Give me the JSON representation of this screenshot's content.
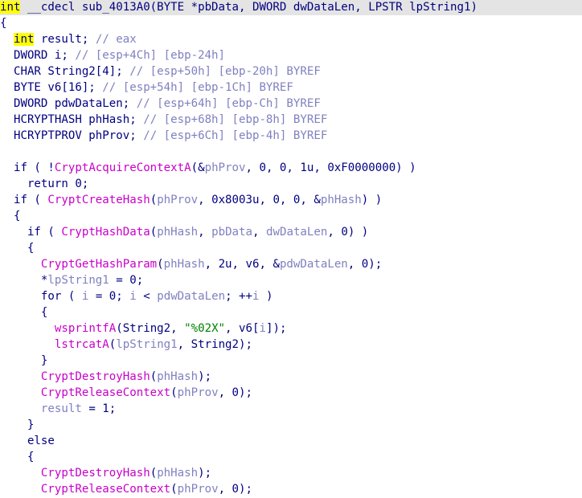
{
  "colors": {
    "default": "#000080",
    "function": "#c800c8",
    "comment": "#8080c0",
    "local_variable": "#8080c0",
    "string": "#008000",
    "current_line_bg": "#e4e4e4",
    "keyword_highlight_bg": "#ffff00"
  },
  "pseudocode": {
    "lines": [
      {
        "highlighted": true,
        "tokens": [
          {
            "t": "int",
            "c": "default",
            "hl": true
          },
          {
            "t": " __cdecl sub_4013A0(BYTE *pbData, DWORD dwDataLen, LPSTR lpString1)",
            "c": "default"
          }
        ]
      },
      {
        "tokens": [
          {
            "t": "{",
            "c": "default"
          }
        ]
      },
      {
        "tokens": [
          {
            "t": "  ",
            "c": "default"
          },
          {
            "t": "int",
            "c": "default",
            "hl": true
          },
          {
            "t": " result; ",
            "c": "default"
          },
          {
            "t": "// eax",
            "c": "comment"
          }
        ]
      },
      {
        "tokens": [
          {
            "t": "  DWORD i; ",
            "c": "default"
          },
          {
            "t": "// [esp+4Ch] [ebp-24h]",
            "c": "comment"
          }
        ]
      },
      {
        "tokens": [
          {
            "t": "  CHAR String2[4]; ",
            "c": "default"
          },
          {
            "t": "// [esp+50h] [ebp-20h] BYREF",
            "c": "comment"
          }
        ]
      },
      {
        "tokens": [
          {
            "t": "  BYTE v6[16]; ",
            "c": "default"
          },
          {
            "t": "// [esp+54h] [ebp-1Ch] BYREF",
            "c": "comment"
          }
        ]
      },
      {
        "tokens": [
          {
            "t": "  DWORD pdwDataLen; ",
            "c": "default"
          },
          {
            "t": "// [esp+64h] [ebp-Ch] BYREF",
            "c": "comment"
          }
        ]
      },
      {
        "tokens": [
          {
            "t": "  HCRYPTHASH phHash; ",
            "c": "default"
          },
          {
            "t": "// [esp+68h] [ebp-8h] BYREF",
            "c": "comment"
          }
        ]
      },
      {
        "tokens": [
          {
            "t": "  HCRYPTPROV phProv; ",
            "c": "default"
          },
          {
            "t": "// [esp+6Ch] [ebp-4h] BYREF",
            "c": "comment"
          }
        ]
      },
      {
        "tokens": []
      },
      {
        "tokens": [
          {
            "t": "  if ( !",
            "c": "default"
          },
          {
            "t": "CryptAcquireContextA",
            "c": "function"
          },
          {
            "t": "(&",
            "c": "default"
          },
          {
            "t": "phProv",
            "c": "local_variable"
          },
          {
            "t": ", 0, 0, 1u, 0xF0000000) )",
            "c": "default"
          }
        ]
      },
      {
        "tokens": [
          {
            "t": "    return 0;",
            "c": "default"
          }
        ]
      },
      {
        "tokens": [
          {
            "t": "  if ( ",
            "c": "default"
          },
          {
            "t": "CryptCreateHash",
            "c": "function"
          },
          {
            "t": "(",
            "c": "default"
          },
          {
            "t": "phProv",
            "c": "local_variable"
          },
          {
            "t": ", 0x8003u, 0, 0, &",
            "c": "default"
          },
          {
            "t": "phHash",
            "c": "local_variable"
          },
          {
            "t": ") )",
            "c": "default"
          }
        ]
      },
      {
        "tokens": [
          {
            "t": "  {",
            "c": "default"
          }
        ]
      },
      {
        "tokens": [
          {
            "t": "    if ( ",
            "c": "default"
          },
          {
            "t": "CryptHashData",
            "c": "function"
          },
          {
            "t": "(",
            "c": "default"
          },
          {
            "t": "phHash",
            "c": "local_variable"
          },
          {
            "t": ", ",
            "c": "default"
          },
          {
            "t": "pbData",
            "c": "local_variable"
          },
          {
            "t": ", ",
            "c": "default"
          },
          {
            "t": "dwDataLen",
            "c": "local_variable"
          },
          {
            "t": ", 0) )",
            "c": "default"
          }
        ]
      },
      {
        "tokens": [
          {
            "t": "    {",
            "c": "default"
          }
        ]
      },
      {
        "tokens": [
          {
            "t": "      ",
            "c": "default"
          },
          {
            "t": "CryptGetHashParam",
            "c": "function"
          },
          {
            "t": "(",
            "c": "default"
          },
          {
            "t": "phHash",
            "c": "local_variable"
          },
          {
            "t": ", 2u, v6, &",
            "c": "default"
          },
          {
            "t": "pdwDataLen",
            "c": "local_variable"
          },
          {
            "t": ", 0);",
            "c": "default"
          }
        ]
      },
      {
        "tokens": [
          {
            "t": "      *",
            "c": "default"
          },
          {
            "t": "lpString1",
            "c": "local_variable"
          },
          {
            "t": " = 0;",
            "c": "default"
          }
        ]
      },
      {
        "tokens": [
          {
            "t": "      for ( ",
            "c": "default"
          },
          {
            "t": "i",
            "c": "local_variable"
          },
          {
            "t": " = 0; ",
            "c": "default"
          },
          {
            "t": "i",
            "c": "local_variable"
          },
          {
            "t": " < ",
            "c": "default"
          },
          {
            "t": "pdwDataLen",
            "c": "local_variable"
          },
          {
            "t": "; ++",
            "c": "default"
          },
          {
            "t": "i",
            "c": "local_variable"
          },
          {
            "t": " )",
            "c": "default"
          }
        ]
      },
      {
        "tokens": [
          {
            "t": "      {",
            "c": "default"
          }
        ]
      },
      {
        "tokens": [
          {
            "t": "        ",
            "c": "default"
          },
          {
            "t": "wsprintfA",
            "c": "function"
          },
          {
            "t": "(String2, ",
            "c": "default"
          },
          {
            "t": "\"%02X\"",
            "c": "string"
          },
          {
            "t": ", v6[",
            "c": "default"
          },
          {
            "t": "i",
            "c": "local_variable"
          },
          {
            "t": "]);",
            "c": "default"
          }
        ]
      },
      {
        "tokens": [
          {
            "t": "        ",
            "c": "default"
          },
          {
            "t": "lstrcatA",
            "c": "function"
          },
          {
            "t": "(",
            "c": "default"
          },
          {
            "t": "lpString1",
            "c": "local_variable"
          },
          {
            "t": ", String2);",
            "c": "default"
          }
        ]
      },
      {
        "tokens": [
          {
            "t": "      }",
            "c": "default"
          }
        ]
      },
      {
        "tokens": [
          {
            "t": "      ",
            "c": "default"
          },
          {
            "t": "CryptDestroyHash",
            "c": "function"
          },
          {
            "t": "(",
            "c": "default"
          },
          {
            "t": "phHash",
            "c": "local_variable"
          },
          {
            "t": ");",
            "c": "default"
          }
        ]
      },
      {
        "tokens": [
          {
            "t": "      ",
            "c": "default"
          },
          {
            "t": "CryptReleaseContext",
            "c": "function"
          },
          {
            "t": "(",
            "c": "default"
          },
          {
            "t": "phProv",
            "c": "local_variable"
          },
          {
            "t": ", 0);",
            "c": "default"
          }
        ]
      },
      {
        "tokens": [
          {
            "t": "      ",
            "c": "default"
          },
          {
            "t": "result",
            "c": "local_variable"
          },
          {
            "t": " = 1;",
            "c": "default"
          }
        ]
      },
      {
        "tokens": [
          {
            "t": "    }",
            "c": "default"
          }
        ]
      },
      {
        "tokens": [
          {
            "t": "    else",
            "c": "default"
          }
        ]
      },
      {
        "tokens": [
          {
            "t": "    {",
            "c": "default"
          }
        ]
      },
      {
        "tokens": [
          {
            "t": "      ",
            "c": "default"
          },
          {
            "t": "CryptDestroyHash",
            "c": "function"
          },
          {
            "t": "(",
            "c": "default"
          },
          {
            "t": "phHash",
            "c": "local_variable"
          },
          {
            "t": ");",
            "c": "default"
          }
        ]
      },
      {
        "tokens": [
          {
            "t": "      ",
            "c": "default"
          },
          {
            "t": "CryptReleaseContext",
            "c": "function"
          },
          {
            "t": "(",
            "c": "default"
          },
          {
            "t": "phProv",
            "c": "local_variable"
          },
          {
            "t": ", 0);",
            "c": "default"
          }
        ]
      }
    ]
  }
}
